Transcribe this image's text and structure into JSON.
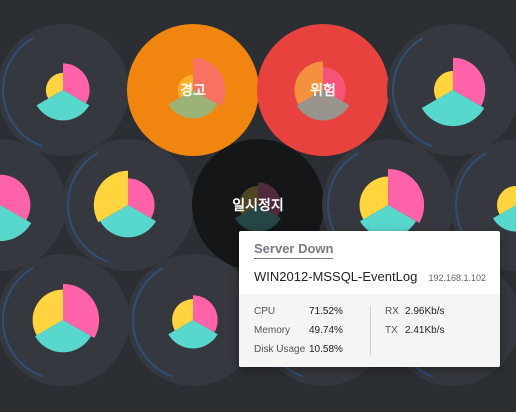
{
  "palette": {
    "background": "#2b2e33",
    "tile": "#35383e",
    "ring": "#2f4f78",
    "yellow": "#ffd43e",
    "pink": "#ff62a8",
    "teal": "#58d8cd",
    "warning": "#f0850f",
    "danger": "#e8423f",
    "paused": "#151618"
  },
  "nodes": [
    {
      "id": "n1",
      "state": "normal",
      "label": "",
      "pie": [
        0.7,
        0.8,
        0.45
      ]
    },
    {
      "id": "n2",
      "state": "warning",
      "label": "경고",
      "pie": [
        0.85,
        0.75,
        0.4
      ]
    },
    {
      "id": "n3",
      "state": "danger",
      "label": "위험",
      "pie": [
        0.6,
        0.8,
        0.75
      ]
    },
    {
      "id": "n4",
      "state": "normal",
      "label": "",
      "pie": [
        0.85,
        0.95,
        0.5
      ]
    },
    {
      "id": "n5",
      "state": "normal",
      "label": "",
      "pie": [
        0.8,
        0.95,
        0.55
      ]
    },
    {
      "id": "n6",
      "state": "normal",
      "label": "",
      "pie": [
        0.7,
        0.85,
        0.9
      ]
    },
    {
      "id": "n7",
      "state": "paused",
      "label": "일시정지",
      "pie": [
        0.6,
        0.7,
        0.5
      ]
    },
    {
      "id": "n8",
      "state": "normal",
      "label": "",
      "pie": [
        0.95,
        0.85,
        0.75
      ]
    },
    {
      "id": "n9",
      "state": "normal",
      "label": "",
      "pie": [
        0.6,
        0.7,
        0.5
      ]
    },
    {
      "id": "n10",
      "state": "normal",
      "label": "",
      "pie": [
        0.95,
        0.85,
        0.8
      ]
    },
    {
      "id": "n11",
      "state": "normal",
      "label": "",
      "pie": [
        0.65,
        0.75,
        0.55
      ]
    },
    {
      "id": "n12",
      "state": "normal",
      "label": "",
      "pie": [
        0.8,
        0.85,
        0.55
      ]
    },
    {
      "id": "n13",
      "state": "normal",
      "label": "",
      "pie": [
        0.7,
        0.9,
        0.6
      ]
    }
  ],
  "tooltip": {
    "title": "Server Down",
    "hostname": "WIN2012-MSSQL-EventLog",
    "ip": "192.168.1.102",
    "metrics": [
      {
        "label": "CPU",
        "value": "71.52%"
      },
      {
        "label": "Memory",
        "value": "49.74%"
      },
      {
        "label": "Disk Usage",
        "value": "10.58%"
      }
    ],
    "network": [
      {
        "label": "RX",
        "value": "2.96Kb/s"
      },
      {
        "label": "TX",
        "value": "2.41Kb/s"
      }
    ]
  }
}
